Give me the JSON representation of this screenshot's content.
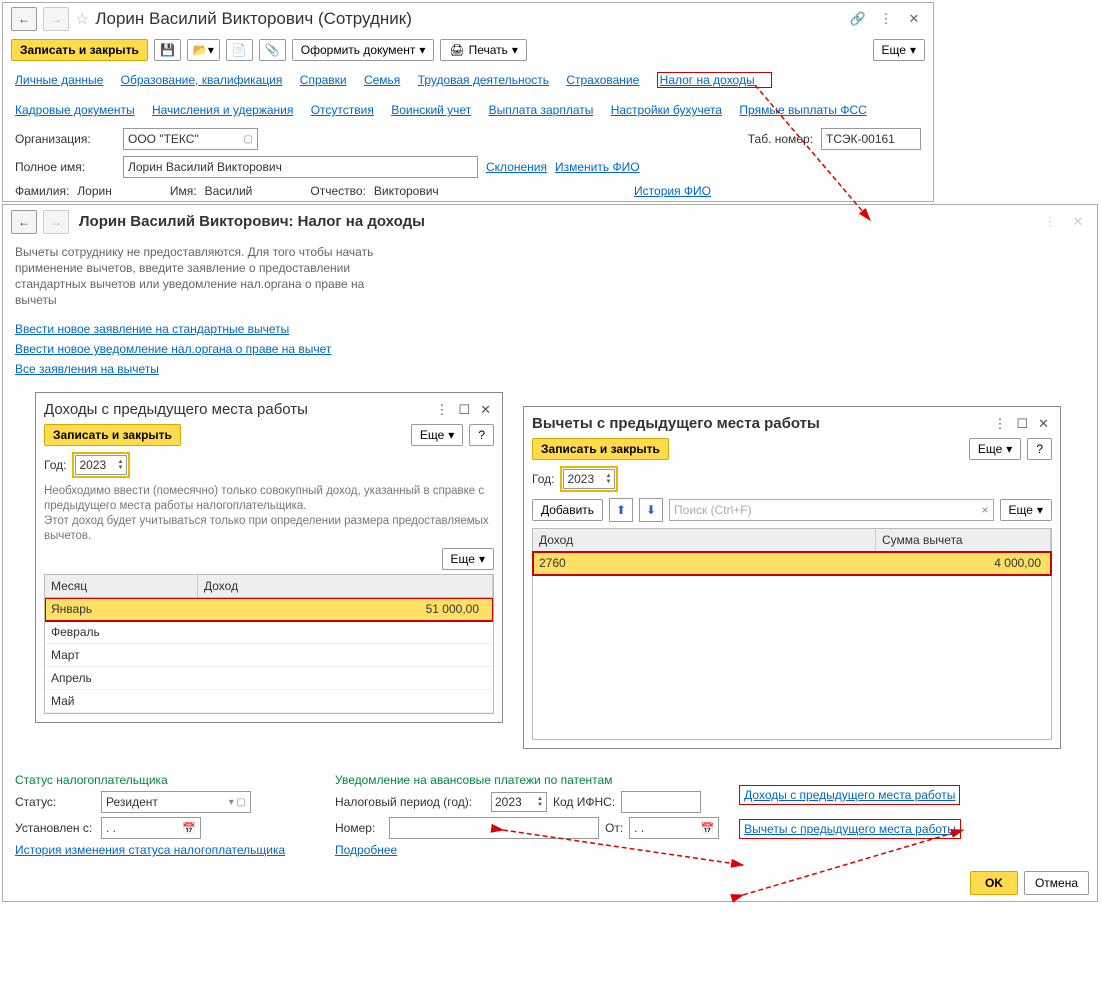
{
  "top": {
    "title": "Лорин Василий Викторович (Сотрудник)",
    "save_close": "Записать и закрыть",
    "more": "Еще",
    "doc_btn": "Оформить документ",
    "print_btn": "Печать",
    "tabs1": [
      "Личные данные",
      "Образование, квалификация",
      "Справки",
      "Семья",
      "Трудовая деятельность",
      "Страхование",
      "Налог на доходы"
    ],
    "tabs2": [
      "Кадровые документы",
      "Начисления и удержания",
      "Отсутствия",
      "Воинский учет",
      "Выплата зарплаты",
      "Настройки бухучета",
      "Прямые выплаты ФСС"
    ],
    "org_lbl": "Организация:",
    "org_val": "ООО \"ТЕКС\"",
    "tab_lbl": "Таб. номер:",
    "tab_val": "ТСЭК-00161",
    "name_lbl": "Полное имя:",
    "name_val": "Лорин Василий Викторович",
    "decl": "Склонения",
    "chg": "Изменить ФИО",
    "fam_lbl": "Фамилия:",
    "fam_val": "Лорин",
    "imya_lbl": "Имя:",
    "imya_val": "Василий",
    "otch_lbl": "Отчество:",
    "otch_val": "Викторович",
    "hist": "История ФИО"
  },
  "sub": {
    "title": "Лорин Василий Викторович: Налог на доходы",
    "note": "Вычеты сотруднику не предоставляются. Для того чтобы начать применение вычетов, введите заявление о предоставлении стандартных вычетов или уведомление нал.органа о праве на вычеты",
    "l1": "Ввести новое заявление на стандартные вычеты",
    "l2": "Ввести новое уведомление нал.органа о праве на вычет",
    "l3": "Все заявления на вычеты"
  },
  "p1": {
    "title": "Доходы с предыдущего места работы",
    "save": "Записать и закрыть",
    "more": "Еще",
    "q": "?",
    "year_lbl": "Год:",
    "year": "2023",
    "note": "Необходимо ввести (помесячно) только совокупный доход, указанный в справке с предыдущего места работы налогоплательщика.\nЭтот доход будет учитываться только при определении размера предоставляемых вычетов.",
    "col_m": "Месяц",
    "col_d": "Доход",
    "rows": [
      {
        "m": "Январь",
        "d": "51 000,00"
      },
      {
        "m": "Февраль",
        "d": ""
      },
      {
        "m": "Март",
        "d": ""
      },
      {
        "m": "Апрель",
        "d": ""
      },
      {
        "m": "Май",
        "d": ""
      }
    ]
  },
  "p2": {
    "title": "Вычеты с предыдущего места работы",
    "save": "Записать и закрыть",
    "more": "Еще",
    "q": "?",
    "year_lbl": "Год:",
    "year": "2023",
    "add": "Добавить",
    "search_ph": "Поиск (Ctrl+F)",
    "col_d": "Доход",
    "col_s": "Сумма вычета",
    "rows": [
      {
        "d": "2760",
        "s": "4 000,00"
      }
    ]
  },
  "bottom": {
    "sec1": "Статус налогоплательщика",
    "sec2": "Уведомление на авансовые платежи по патентам",
    "status_lbl": "Статус:",
    "status_val": "Резидент",
    "period_lbl": "Налоговый период (год):",
    "period_val": "2023",
    "ifns": "Код ИФНС:",
    "ust": "Установлен с:",
    "ust_val": ". .",
    "num": "Номер:",
    "ot": "От:",
    "ot_val": ". .",
    "hist": "История изменения статуса налогоплательщика",
    "more": "Подробнее",
    "link1": "Доходы с предыдущего места работы",
    "link2": "Вычеты с предыдущего места работы",
    "ok": "OK",
    "cancel": "Отмена"
  }
}
